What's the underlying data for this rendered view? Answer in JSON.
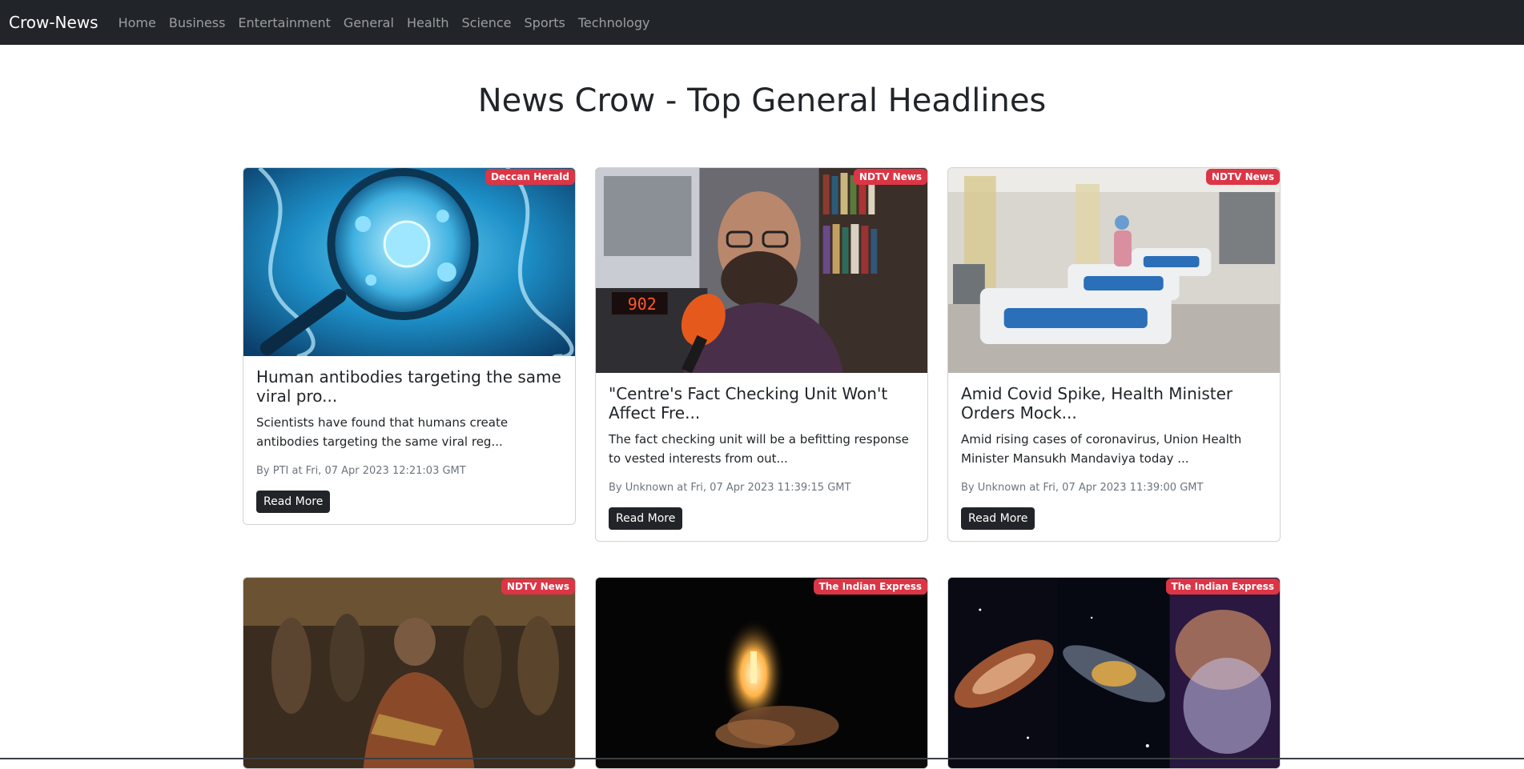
{
  "nav": {
    "brand": "Crow-News",
    "links": [
      "Home",
      "Business",
      "Entertainment",
      "General",
      "Health",
      "Science",
      "Sports",
      "Technology"
    ]
  },
  "page": {
    "title": "News Crow - Top General Headlines"
  },
  "articles": [
    {
      "source": "Deccan Herald",
      "title": "Human antibodies targeting the same viral pro...",
      "description": "Scientists have found that humans create antibodies targeting the same viral reg...",
      "meta": "By PTI at Fri, 07 Apr 2023 12:21:03 GMT",
      "button": "Read More",
      "image": "dna-virus-magnifier"
    },
    {
      "source": "NDTV News",
      "title": "\"Centre's Fact Checking Unit Won't Affect Fre...",
      "description": "The fact checking unit will be a befitting response to vested interests from out...",
      "meta": "By Unknown at Fri, 07 Apr 2023 11:39:15 GMT",
      "button": "Read More",
      "image": "man-interview-bookshelf"
    },
    {
      "source": "NDTV News",
      "title": "Amid Covid Spike, Health Minister Orders Mock...",
      "description": "Amid rising cases of coronavirus, Union Health Minister Mansukh Mandaviya today ...",
      "meta": "By Unknown at Fri, 07 Apr 2023 11:39:00 GMT",
      "button": "Read More",
      "image": "hospital-ward"
    },
    {
      "source": "NDTV News",
      "image": "film-still-crowd"
    },
    {
      "source": "The Indian Express",
      "image": "rocket-launch-night"
    },
    {
      "source": "The Indian Express",
      "image": "galaxy-images"
    }
  ],
  "colors": {
    "navbar": "#212529",
    "badge": "#dc3545",
    "button": "#212529"
  }
}
